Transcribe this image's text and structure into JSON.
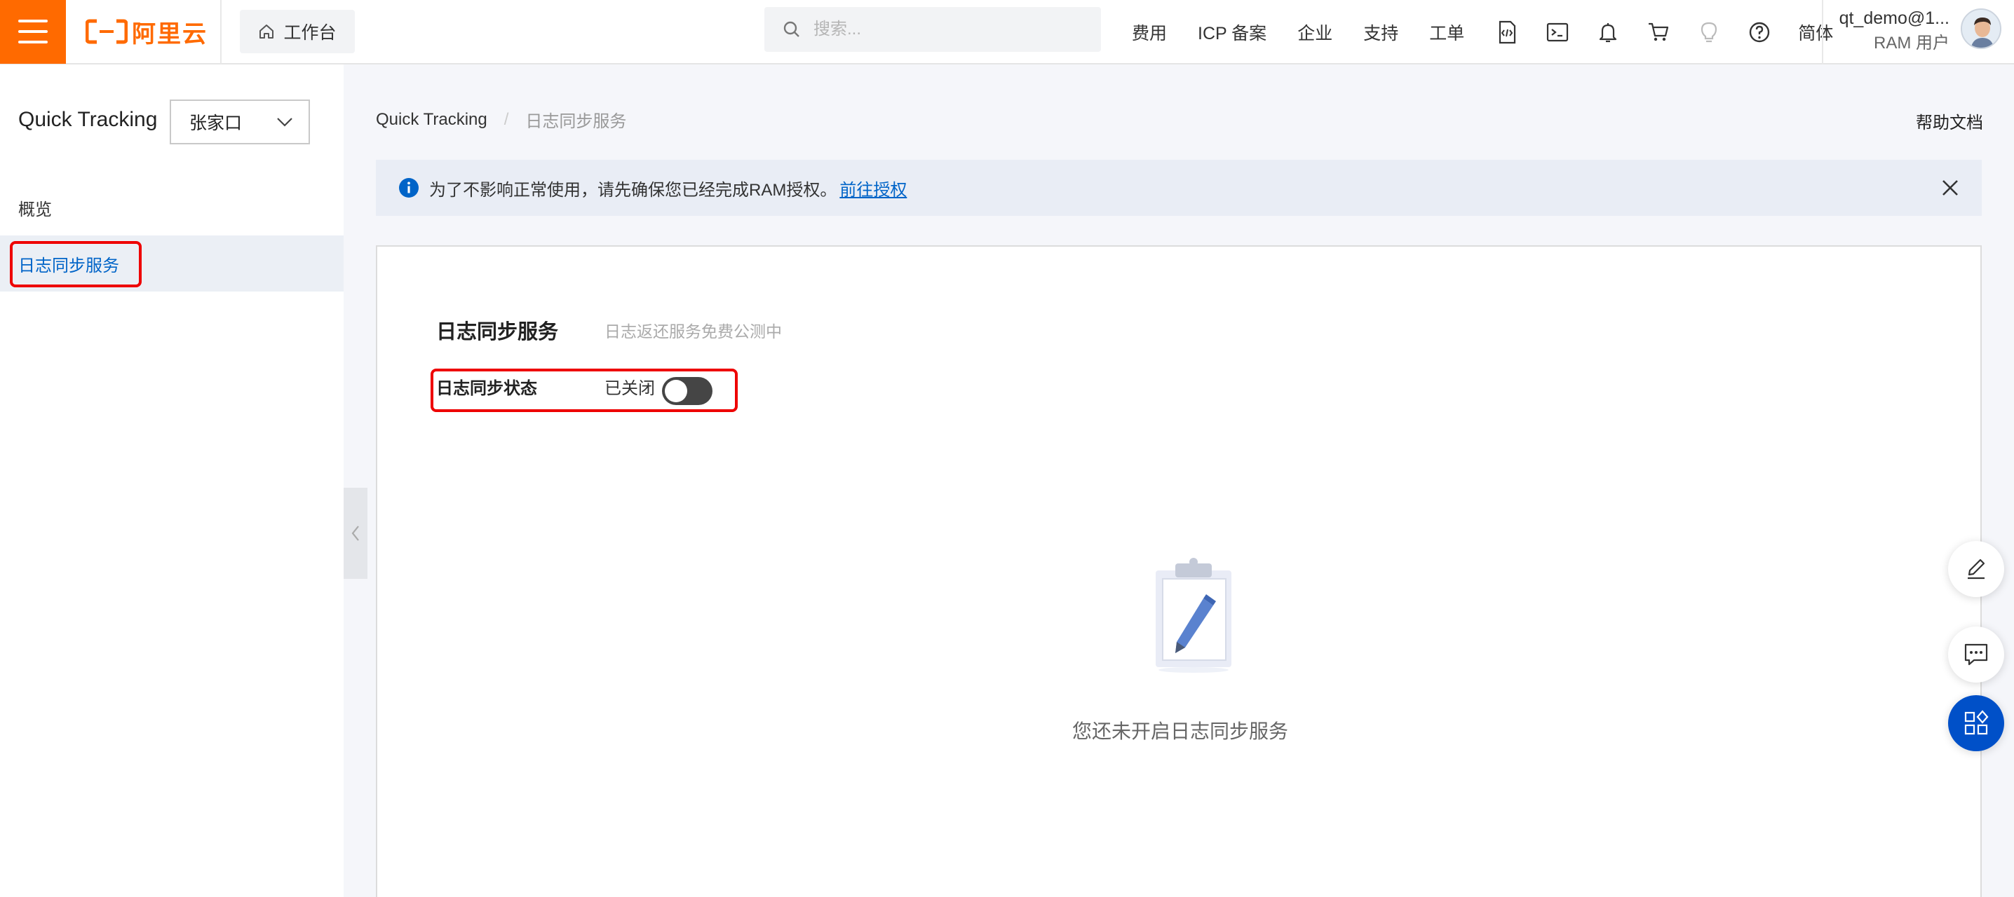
{
  "topbar": {
    "logo_text": "阿里云",
    "workbench_label": "工作台",
    "search_placeholder": "搜索...",
    "nav": [
      "费用",
      "ICP 备案",
      "企业",
      "支持",
      "工单"
    ],
    "icons": [
      "code-icon",
      "terminal-icon",
      "bell-icon",
      "cart-icon",
      "bulb-icon",
      "help-icon"
    ],
    "lang": "简体",
    "user_name": "qt_demo@1...",
    "user_role": "RAM 用户"
  },
  "sidebar": {
    "title": "Quick Tracking",
    "region": "张家口",
    "items": [
      {
        "label": "概览",
        "active": false
      },
      {
        "label": "日志同步服务",
        "active": true
      }
    ]
  },
  "breadcrumb": {
    "root": "Quick Tracking",
    "separator": "/",
    "current": "日志同步服务"
  },
  "help_doc": "帮助文档",
  "notice": {
    "text": "为了不影响正常使用，请先确保您已经完成RAM授权。",
    "link": "前往授权"
  },
  "panel": {
    "title": "日志同步服务",
    "subtitle": "日志返还服务免费公测中",
    "status_label": "日志同步状态",
    "status_value": "已关闭",
    "toggle_on": false,
    "empty_text": "您还未开启日志同步服务"
  },
  "colors": {
    "brand": "#ff6a00",
    "link": "#0064c8",
    "highlight_box": "#ee0000",
    "toggle_off": "#454545"
  }
}
